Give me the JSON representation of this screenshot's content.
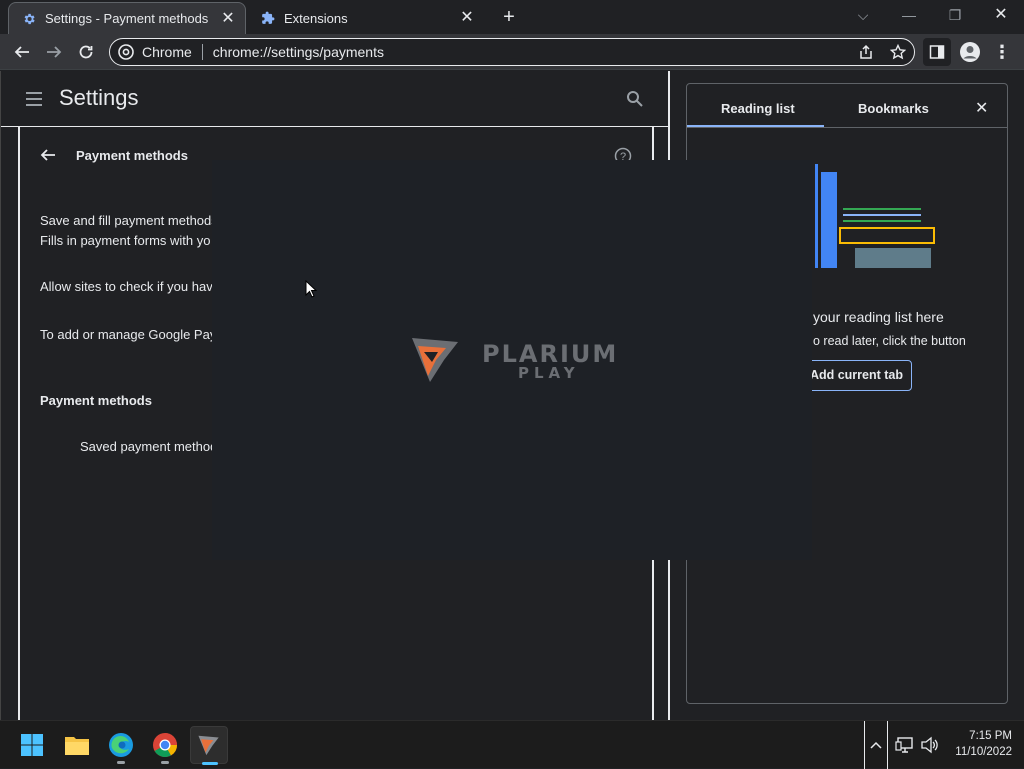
{
  "tabs": [
    {
      "label": "Settings - Payment methods",
      "icon": "gear-icon",
      "active": true
    },
    {
      "label": "Extensions",
      "icon": "puzzle-icon",
      "active": false
    }
  ],
  "toolbar": {
    "chip_label": "Chrome",
    "url": "chrome://settings/payments"
  },
  "settings": {
    "title": "Settings",
    "subpage_title": "Payment methods",
    "save_fill_title": "Save and fill payment methods",
    "save_fill_desc": "Fills in payment forms with yo",
    "allow_sites": "Allow sites to check if you hav",
    "google_pay": "To add or manage Google Pay",
    "section_heading": "Payment methods",
    "saved_methods": "Saved payment method"
  },
  "side_panel": {
    "tab_reading_list": "Reading list",
    "tab_bookmarks": "Bookmarks",
    "empty_title": "your reading list here",
    "empty_desc": "o read later, click the button",
    "add_button": "Add current tab"
  },
  "splash": {
    "brand_line1": "PLARIUM",
    "brand_line2": "PLAY"
  },
  "taskbar": {
    "time": "7:15 PM",
    "date": "11/10/2022"
  },
  "colors": {
    "accent_blue": "#8ab4f8",
    "page_bg": "#202124",
    "toolbar_bg": "#35363a",
    "splash_bg": "#1e2126",
    "plarium_orange": "#e8703a"
  }
}
